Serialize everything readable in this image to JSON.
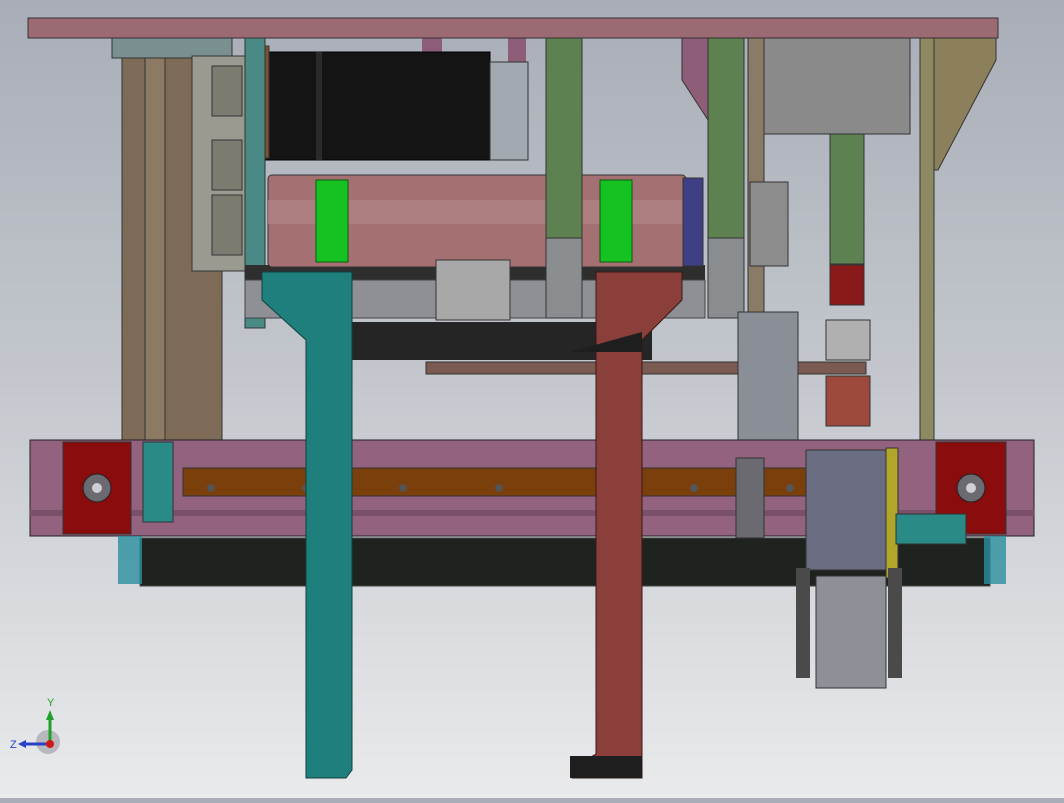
{
  "viewport": {
    "title": "",
    "background_top": "#a8adb7",
    "background_bottom": "#e9eaec"
  },
  "triad": {
    "x_label": "",
    "y_label": "Y",
    "z_label": "Z",
    "colors": {
      "y": "#1fa02a",
      "z": "#2a40c8",
      "origin": "#d01818"
    }
  },
  "colors": {
    "top_plate": "#9c6a72",
    "base_rail": "#93627f",
    "end_block": "#8a0c0c",
    "front_bar": "#7b3f0b",
    "base_plate": "#1f2320",
    "roller": "#a47072",
    "green_band": "#16c222",
    "motor": "#141414",
    "teal_arm": "#1e7f7c",
    "red_arm": "#8a3f3a",
    "cylinder": "#5e8152",
    "frame_tan": "#7e6b57"
  }
}
